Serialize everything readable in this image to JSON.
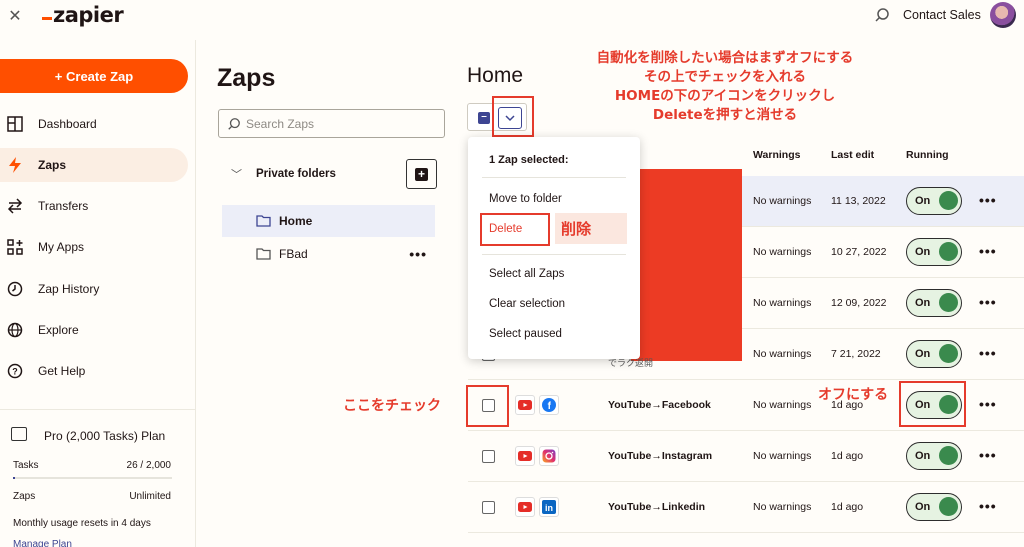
{
  "topbar": {
    "close_glyph": "✕",
    "logo_text": "zapier",
    "contact_label": "Contact Sales"
  },
  "sidebar": {
    "create_label": "+ Create Zap",
    "items": [
      {
        "label": "Dashboard",
        "icon": "dashboard-icon"
      },
      {
        "label": "Zaps",
        "icon": "zap-bolt-icon",
        "active": true
      },
      {
        "label": "Transfers",
        "icon": "transfer-arrows-icon"
      },
      {
        "label": "My Apps",
        "icon": "apps-grid-icon"
      },
      {
        "label": "Zap History",
        "icon": "clock-icon"
      },
      {
        "label": "Explore",
        "icon": "globe-icon"
      },
      {
        "label": "Get Help",
        "icon": "help-icon"
      }
    ],
    "plan": {
      "title": "Pro (2,000 Tasks) Plan",
      "tasks_label": "Tasks",
      "tasks_value": "26 / 2,000",
      "tasks_fraction": 0.013,
      "zaps_label": "Zaps",
      "zaps_value": "Unlimited",
      "reset_note": "Monthly usage resets in 4 days",
      "manage_label": "Manage Plan"
    }
  },
  "folders": {
    "title": "Zaps",
    "search_placeholder": "Search Zaps",
    "private_label": "Private folders",
    "items": [
      {
        "label": "Home",
        "active": true
      },
      {
        "label": "FBad"
      }
    ],
    "more_glyph": "•••"
  },
  "main": {
    "title": "Home",
    "columns": {
      "warnings": "Warnings",
      "last_edit": "Last edit",
      "running": "Running"
    },
    "dropdown": {
      "header": "1 Zap selected:",
      "items": [
        "Move to folder",
        "Delete",
        "Select all Zaps",
        "Clear selection",
        "Select paused"
      ]
    },
    "partial_name_fragment": "でラク返開",
    "rows": [
      {
        "name": "",
        "warnings": "No warnings",
        "last_edit": "11 13, 2022",
        "running": "On"
      },
      {
        "name": "",
        "warnings": "No warnings",
        "last_edit": "10 27, 2022",
        "running": "On"
      },
      {
        "name": "",
        "warnings": "No warnings",
        "last_edit": "12 09, 2022",
        "running": "On"
      },
      {
        "name": "",
        "warnings": "No warnings",
        "last_edit": "7 21, 2022",
        "running": "On"
      },
      {
        "name": "YouTube→Facebook",
        "warnings": "No warnings",
        "last_edit": "1d ago",
        "running": "On",
        "app2": "facebook-icon"
      },
      {
        "name": "YouTube→Instagram",
        "warnings": "No warnings",
        "last_edit": "1d ago",
        "running": "On",
        "app2": "instagram-icon"
      },
      {
        "name": "YouTube→Linkedin",
        "warnings": "No warnings",
        "last_edit": "1d ago",
        "running": "On",
        "app2": "linkedin-icon"
      }
    ]
  },
  "annotations": {
    "top_line1": "自動化を削除したい場合はまずオフにする",
    "top_line2": "その上でチェックを入れる",
    "top_line3": "HOMEの下のアイコンをクリックし",
    "top_line4": "Deleteを押すと消せる",
    "delete_note": "削除",
    "check_here": "ここをチェック",
    "turn_off": "オフにする"
  },
  "colors": {
    "brand": "#ff4f00",
    "annotation_red": "#e53b2c",
    "accent_navy": "#3d4592",
    "toggle_green": "#3a8a4d"
  }
}
